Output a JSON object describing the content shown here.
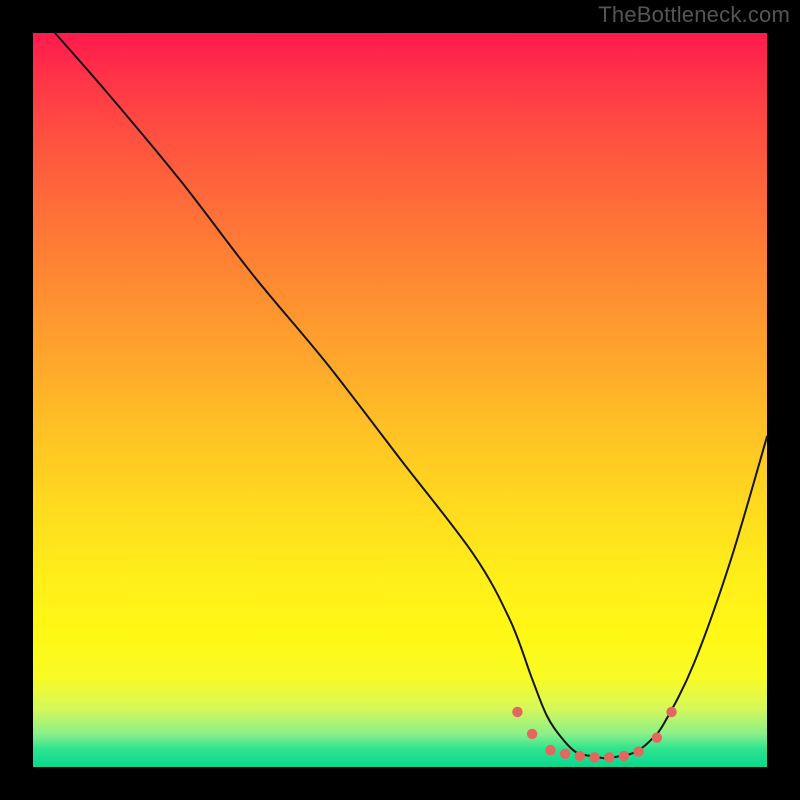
{
  "watermark": "TheBottleneck.com",
  "chart_data": {
    "type": "line",
    "title": "",
    "xlabel": "",
    "ylabel": "",
    "xlim": [
      0,
      100
    ],
    "ylim": [
      0,
      100
    ],
    "grid": false,
    "series": [
      {
        "name": "curve",
        "x": [
          3,
          10,
          20,
          30,
          40,
          50,
          60,
          65,
          68,
          70,
          72,
          74,
          76,
          78,
          80,
          82,
          84,
          86,
          90,
          95,
          100
        ],
        "values": [
          100,
          92,
          80,
          67,
          55,
          42,
          29,
          20,
          12,
          7,
          4,
          2,
          1.5,
          1.2,
          1.5,
          2,
          3.5,
          6,
          14,
          28,
          45
        ]
      }
    ],
    "markers": {
      "name": "highlight-dots",
      "x": [
        66,
        68,
        70.5,
        72.5,
        74.5,
        76.5,
        78.5,
        80.5,
        82.5,
        85,
        87
      ],
      "values": [
        7.5,
        4.5,
        2.3,
        1.8,
        1.5,
        1.3,
        1.3,
        1.5,
        2.1,
        4.0,
        7.5
      ]
    },
    "colors": {
      "curve_stroke": "#151515",
      "marker_fill": "#e4665f",
      "gradient_top": "#ff1a4d",
      "gradient_bottom": "#09d88f",
      "frame": "#000000"
    }
  }
}
